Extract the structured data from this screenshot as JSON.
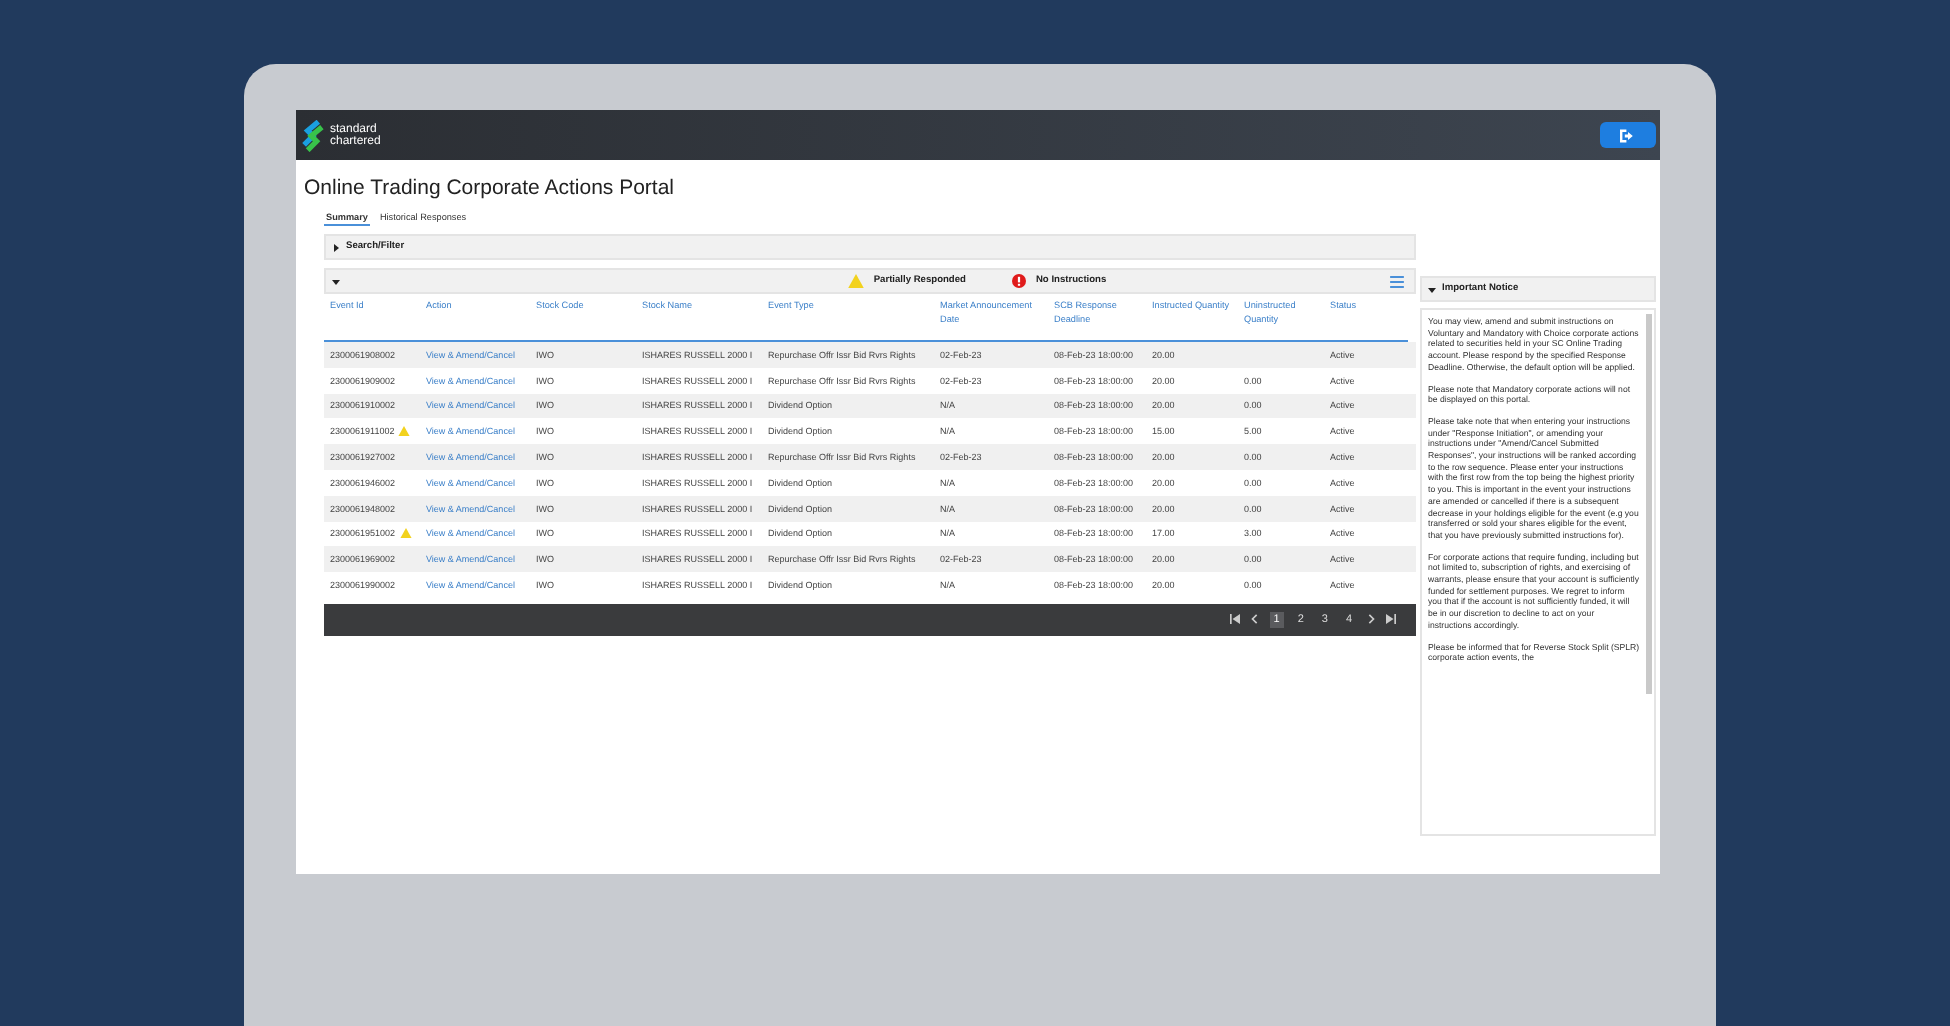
{
  "logo": {
    "line1": "standard",
    "line2": "chartered"
  },
  "page_title": "Online Trading Corporate Actions Portal",
  "tabs": [
    {
      "label": "Summary",
      "selected": true
    },
    {
      "label": "Historical Responses",
      "selected": false
    }
  ],
  "search_filter": {
    "label": "Search/Filter",
    "expanded": false
  },
  "legend": [
    {
      "kind": "warning",
      "label": "Partially Responded"
    },
    {
      "kind": "error",
      "label": "No Instructions"
    }
  ],
  "table": {
    "columns": [
      "Event Id",
      "Action",
      "Stock Code",
      "Stock Name",
      "Event Type",
      "Market Announcement Date",
      "SCB Response Deadline",
      "Instructed Quantity",
      "Uninstructed Quantity",
      "Status"
    ],
    "rows": [
      {
        "event_id": "2300061908002",
        "warning": false,
        "action": "View & Amend/Cancel",
        "stock_code": "IWO",
        "stock_name": "ISHARES RUSSELL 2000 I",
        "event_type": "Repurchase Offr Issr Bid Rvrs Rights",
        "announcement": "02-Feb-23",
        "deadline": "08-Feb-23 18:00:00",
        "instructed": "20.00",
        "status": "Active"
      },
      {
        "event_id": "2300061909002",
        "warning": false,
        "action": "View & Amend/Cancel",
        "stock_code": "IWO",
        "stock_name": "ISHARES RUSSELL 2000 I",
        "event_type": "Repurchase Offr Issr Bid Rvrs Rights",
        "announcement": "02-Feb-23",
        "deadline": "08-Feb-23 18:00:00",
        "instructed": "20.00",
        "uninstructed": "0.00",
        "status": "Active"
      },
      {
        "event_id": "2300061910002",
        "warning": false,
        "action": "View & Amend/Cancel",
        "stock_code": "IWO",
        "stock_name": "ISHARES RUSSELL 2000 I",
        "event_type": "Dividend Option",
        "announcement": "N/A",
        "deadline": "08-Feb-23 18:00:00",
        "instructed": "20.00",
        "uninstructed": "0.00",
        "status": "Active"
      },
      {
        "event_id": "2300061911002",
        "warning": true,
        "action": "View & Amend/Cancel",
        "stock_code": "IWO",
        "stock_name": "ISHARES RUSSELL 2000 I",
        "event_type": "Dividend Option",
        "announcement": "N/A",
        "deadline": "08-Feb-23 18:00:00",
        "instructed": "15.00",
        "uninstructed": "5.00",
        "status": "Active"
      },
      {
        "event_id": "2300061927002",
        "warning": false,
        "action": "View & Amend/Cancel",
        "stock_code": "IWO",
        "stock_name": "ISHARES RUSSELL 2000 I",
        "event_type": "Repurchase Offr Issr Bid Rvrs Rights",
        "announcement": "02-Feb-23",
        "deadline": "08-Feb-23 18:00:00",
        "instructed": "20.00",
        "uninstructed": "0.00",
        "status": "Active"
      },
      {
        "event_id": "2300061946002",
        "warning": false,
        "action": "View & Amend/Cancel",
        "stock_code": "IWO",
        "stock_name": "ISHARES RUSSELL 2000 I",
        "event_type": "Dividend Option",
        "announcement": "N/A",
        "deadline": "08-Feb-23 18:00:00",
        "instructed": "20.00",
        "uninstructed": "0.00",
        "status": "Active"
      },
      {
        "event_id": "2300061948002",
        "warning": false,
        "action": "View & Amend/Cancel",
        "stock_code": "IWO",
        "stock_name": "ISHARES RUSSELL 2000 I",
        "event_type": "Dividend Option",
        "announcement": "N/A",
        "deadline": "08-Feb-23 18:00:00",
        "instructed": "20.00",
        "uninstructed": "0.00",
        "status": "Active"
      },
      {
        "event_id": "2300061951002",
        "warning": true,
        "action": "View & Amend/Cancel",
        "stock_code": "IWO",
        "stock_name": "ISHARES RUSSELL 2000 I",
        "event_type": "Dividend Option",
        "announcement": "N/A",
        "deadline": "08-Feb-23 18:00:00",
        "instructed": "17.00",
        "uninstructed": "3.00",
        "status": "Active"
      },
      {
        "event_id": "2300061969002",
        "warning": false,
        "action": "View & Amend/Cancel",
        "stock_code": "IWO",
        "stock_name": "ISHARES RUSSELL 2000 I",
        "event_type": "Repurchase Offr Issr Bid Rvrs Rights",
        "announcement": "02-Feb-23",
        "deadline": "08-Feb-23 18:00:00",
        "instructed": "20.00",
        "uninstructed": "0.00",
        "status": "Active"
      },
      {
        "event_id": "2300061990002",
        "warning": false,
        "action": "View & Amend/Cancel",
        "stock_code": "IWO",
        "stock_name": "ISHARES RUSSELL 2000 I",
        "event_type": "Dividend Option",
        "announcement": "N/A",
        "deadline": "08-Feb-23 18:00:00",
        "instructed": "20.00",
        "uninstructed": "0.00",
        "status": "Active"
      }
    ]
  },
  "pagination": {
    "pages": [
      {
        "label": "1",
        "selected": true
      },
      {
        "label": "2",
        "selected": false
      },
      {
        "label": "3",
        "selected": false
      },
      {
        "label": "4",
        "selected": false
      }
    ]
  },
  "notice": {
    "title": "Important Notice",
    "expanded": true,
    "paragraphs": [
      "You may view, amend and submit instructions on Voluntary and Mandatory with Choice corporate actions related to securities held in your SC Online Trading account. Please respond by the specified Response Deadline. Otherwise, the default option will be applied.",
      "Please note that Mandatory corporate actions will not be displayed on this portal.",
      "Please take note that when entering your instructions under \"Response Initiation\", or amending your instructions under \"Amend/Cancel Submitted Responses\", your instructions will be ranked according to the row sequence. Please enter your instructions with the first row from the top being the highest priority to you. This is important in the event your instructions are amended or cancelled if there is a subsequent decrease in your holdings eligible for the event (e.g you transferred or sold your shares eligible for the event, that you have previously submitted instructions for).",
      "For corporate actions that require funding, including but not limited to, subscription of rights, and exercising of warrants, please ensure that your account is sufficiently funded for settlement purposes. We regret to inform you that if the account is not sufficiently funded, it will be in our discretion to decline to act on your instructions accordingly.",
      "Please be informed that for Reverse Stock Split (SPLR) corporate action events, the"
    ]
  }
}
